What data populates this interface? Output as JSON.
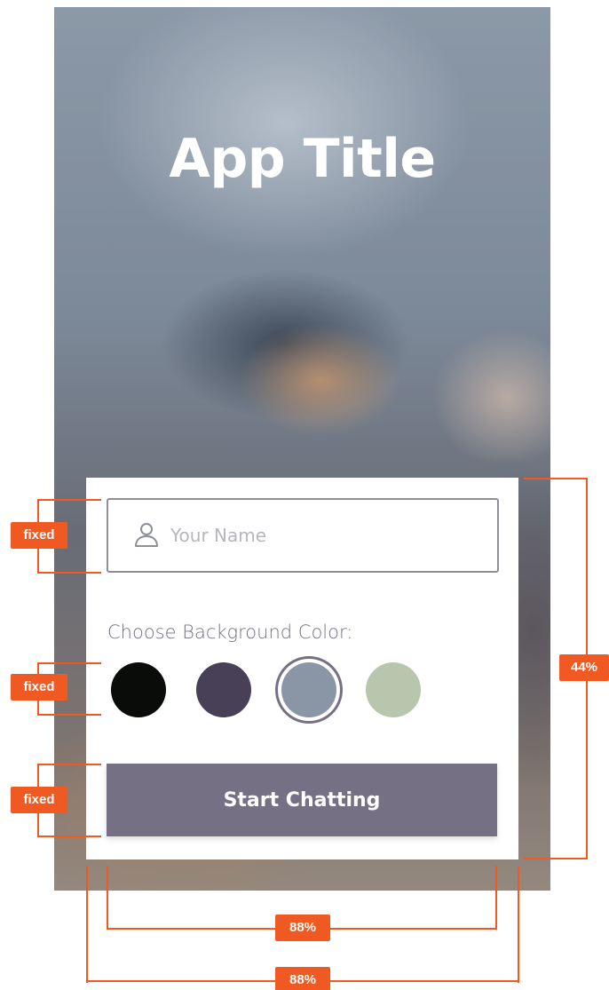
{
  "app": {
    "title": "App Title"
  },
  "start_form": {
    "name_placeholder": "Your Name",
    "name_value": "",
    "name_icon": "user-icon",
    "color_label": "Choose Background Color:",
    "colors": [
      "#090c08",
      "#474056",
      "#8a95a5",
      "#b9c6ae"
    ],
    "selected_color_index": 2,
    "button_label": "Start Chatting",
    "button_color": "#757083"
  },
  "annotations": {
    "input_height": "fixed",
    "swatch_height": "fixed",
    "button_height": "fixed",
    "card_height": "44%",
    "content_width": "88%",
    "card_width": "88%",
    "accent_color": "#f05a22"
  }
}
